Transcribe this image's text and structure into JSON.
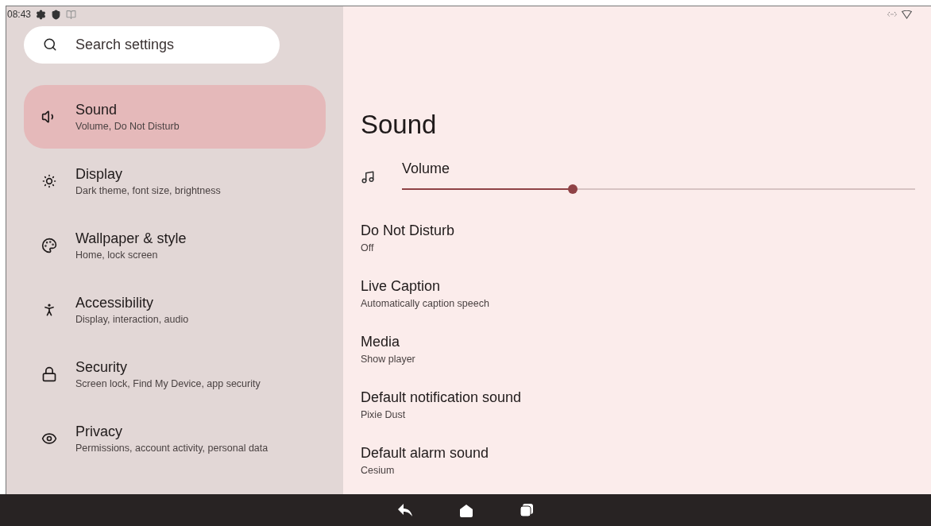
{
  "status_bar": {
    "time": "08:43"
  },
  "search": {
    "placeholder": "Search settings"
  },
  "sidebar": {
    "items": [
      {
        "kind": "sound",
        "title": "Sound",
        "subtitle": "Volume, Do Not Disturb",
        "selected": true
      },
      {
        "kind": "display",
        "title": "Display",
        "subtitle": "Dark theme, font size, brightness",
        "selected": false
      },
      {
        "kind": "wallpaper",
        "title": "Wallpaper & style",
        "subtitle": "Home, lock screen",
        "selected": false
      },
      {
        "kind": "accessibility",
        "title": "Accessibility",
        "subtitle": "Display, interaction, audio",
        "selected": false
      },
      {
        "kind": "security",
        "title": "Security",
        "subtitle": "Screen lock, Find My Device, app security",
        "selected": false
      },
      {
        "kind": "privacy",
        "title": "Privacy",
        "subtitle": "Permissions, account activity, personal data",
        "selected": false
      }
    ]
  },
  "page": {
    "title": "Sound",
    "volume": {
      "label": "Volume",
      "level": 0.33
    },
    "settings": [
      {
        "title": "Do Not Disturb",
        "subtitle": "Off"
      },
      {
        "title": "Live Caption",
        "subtitle": "Automatically caption speech"
      },
      {
        "title": "Media",
        "subtitle": "Show player"
      },
      {
        "title": "Default notification sound",
        "subtitle": "Pixie Dust"
      },
      {
        "title": "Default alarm sound",
        "subtitle": "Cesium"
      }
    ]
  }
}
